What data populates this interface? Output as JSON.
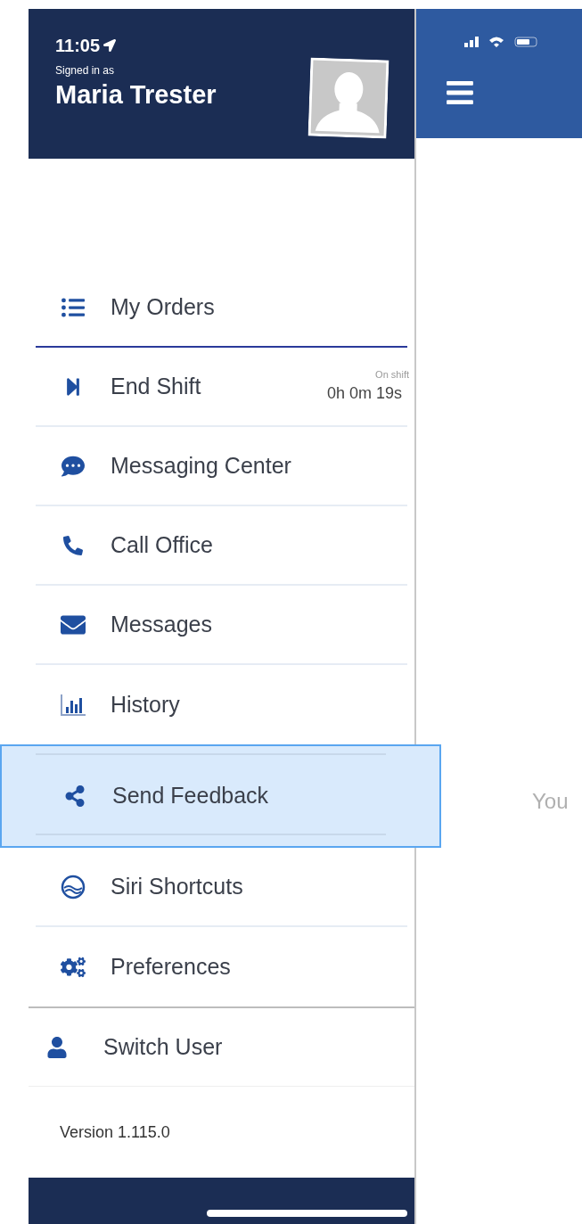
{
  "status_bar": {
    "time": "11:05"
  },
  "profile": {
    "caption": "Signed in as",
    "name": "Maria Trester"
  },
  "menu": [
    {
      "label": "My Orders",
      "active": true,
      "selected": false
    },
    {
      "label": "End Shift",
      "active": false,
      "selected": false,
      "shift_caption": "On shift",
      "shift_time": "0h 0m 19s"
    },
    {
      "label": "Messaging Center",
      "active": false,
      "selected": false
    },
    {
      "label": "Call Office",
      "active": false,
      "selected": false
    },
    {
      "label": "Messages",
      "active": false,
      "selected": false
    },
    {
      "label": "History",
      "active": false,
      "selected": false
    },
    {
      "label": "Send Feedback",
      "active": false,
      "selected": true
    },
    {
      "label": "Siri Shortcuts",
      "active": false,
      "selected": false
    },
    {
      "label": "Preferences",
      "active": false,
      "selected": false
    }
  ],
  "switch_user": {
    "label": "Switch User"
  },
  "version": "Version 1.115.0",
  "main": {
    "message": "You"
  }
}
